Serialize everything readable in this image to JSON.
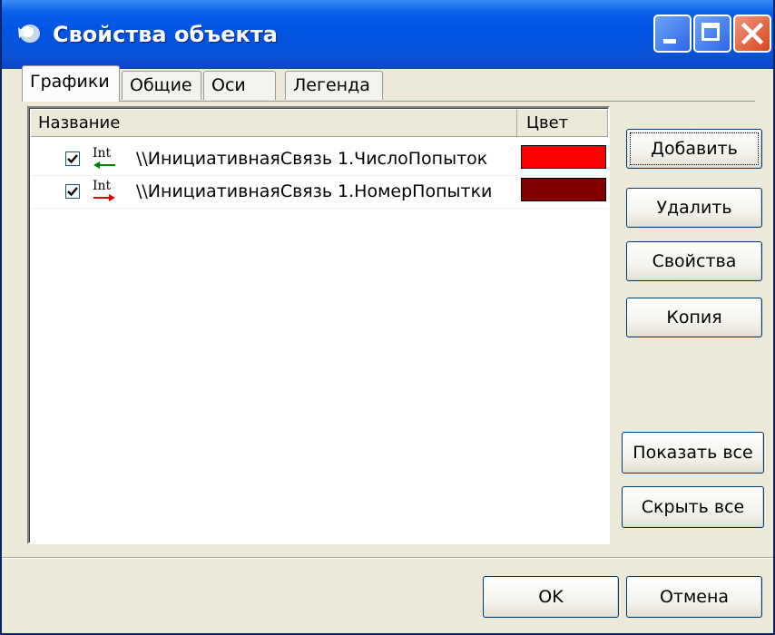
{
  "window": {
    "title": "Свойства объекта",
    "titlebar_color": "#0054e3"
  },
  "tabs": [
    {
      "label": "Графики",
      "active": true
    },
    {
      "label": "Общие",
      "active": false
    },
    {
      "label": "Оси",
      "active": false
    },
    {
      "label": "Легенда",
      "active": false
    }
  ],
  "list": {
    "columns": [
      "Название",
      "Цвет"
    ],
    "rows": [
      {
        "checked": true,
        "icon": "int-arrow-left-green-icon",
        "icon_text": "Int",
        "name": "\\\\ИнициативнаяСвязь 1.ЧислоПопыток",
        "color": "#ff0000"
      },
      {
        "checked": true,
        "icon": "int-arrow-right-red-icon",
        "icon_text": "Int",
        "name": "\\\\ИнициативнаяСвязь 1.НомерПопытки",
        "color": "#800000"
      }
    ]
  },
  "buttons": {
    "add": "Добавить",
    "delete": "Удалить",
    "properties": "Свойства",
    "copy": "Копия",
    "show_all": "Показать все",
    "hide_all": "Скрыть все",
    "ok": "OK",
    "cancel": "Отмена"
  }
}
